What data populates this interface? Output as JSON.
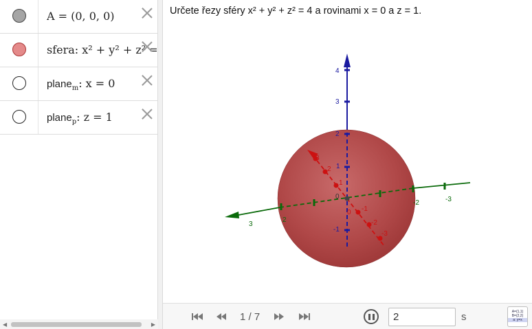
{
  "algebra": {
    "rows": [
      {
        "marble": "grey",
        "label": "A",
        "expr": "A = (0, 0, 0)"
      },
      {
        "marble": "red",
        "label": "sfera",
        "expr": "sfera: x² + y² + z² ="
      },
      {
        "marble": "empty",
        "label": "plane_m",
        "name": "plane",
        "sub": "m",
        "expr": ": x = 0"
      },
      {
        "marble": "empty",
        "label": "plane_p",
        "name": "plane",
        "sub": "p",
        "expr": ": z = 1"
      }
    ],
    "scroll_left": "◀",
    "scroll_right": "▶"
  },
  "graphics": {
    "task": "Určete řezy sféry x² + y² + z² = 4 a rovinami x = 0 a z = 1.",
    "z_ticks": [
      "4",
      "3",
      "2",
      "1",
      "-1"
    ],
    "y_ticks": [
      "-2",
      "-3",
      "2",
      "3"
    ],
    "x_ticks": [
      "3",
      "2",
      "1",
      "0",
      "-1",
      "-2",
      "-3"
    ],
    "origin_label": "0",
    "colors": {
      "sphere": "#b23a3a",
      "x_axis": "#cc0000",
      "y_axis": "#006400",
      "z_axis": "#0000aa"
    }
  },
  "animation": {
    "slide": "1 / 7",
    "speed": "2",
    "unit": "s",
    "algebra_button_lines": [
      "A=(1,1)",
      "B=(2,2)",
      "a: y=x"
    ]
  }
}
